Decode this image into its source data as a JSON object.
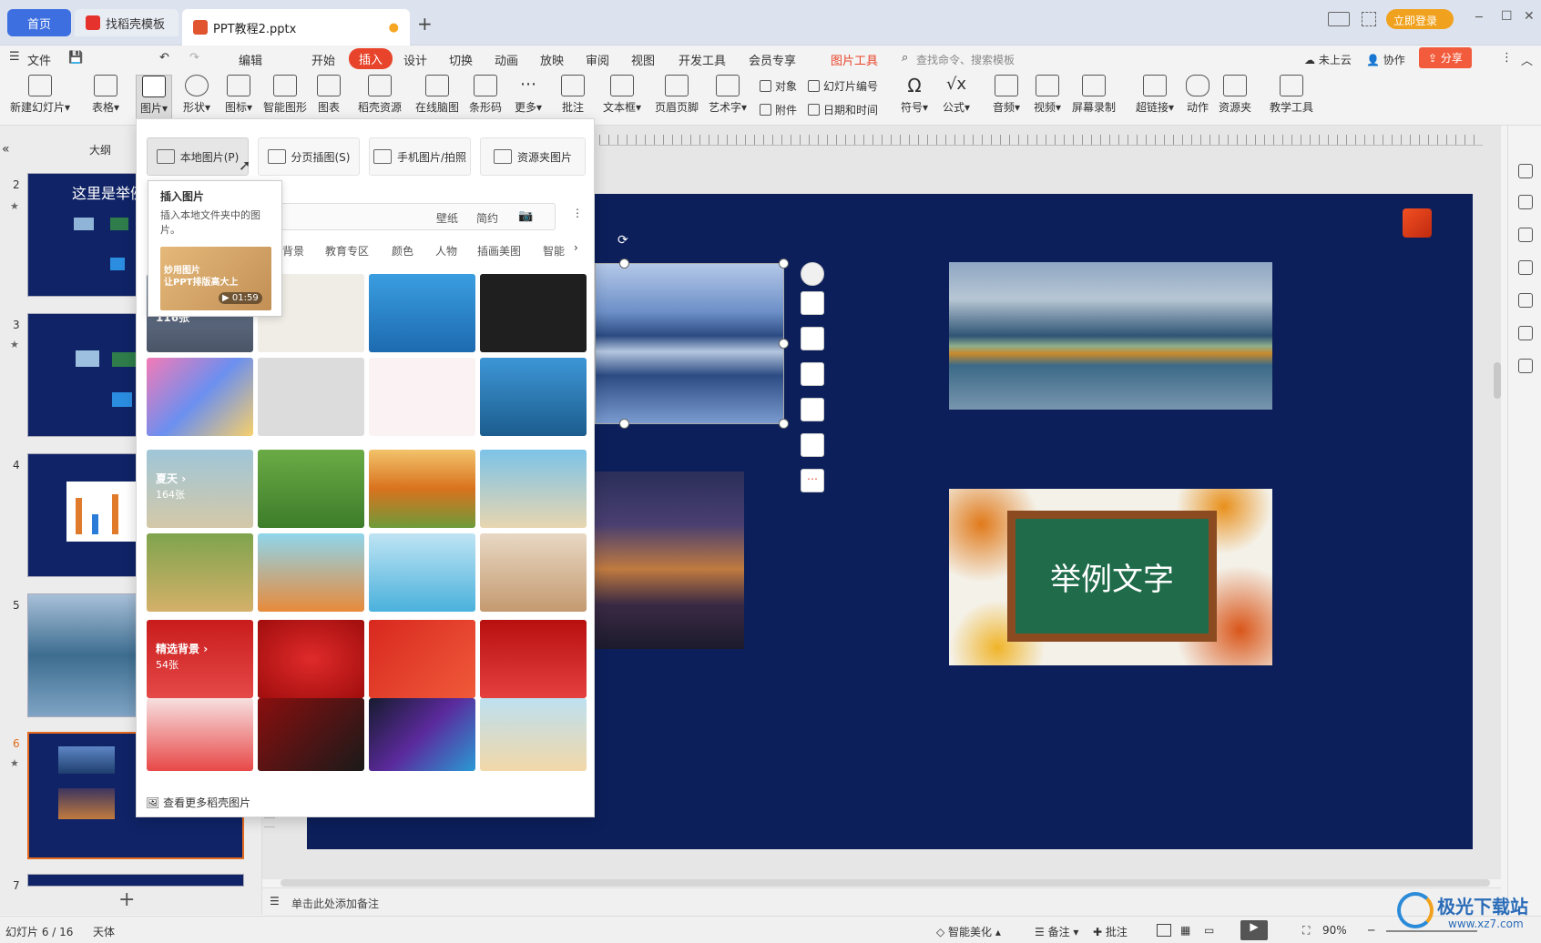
{
  "tabs": {
    "home": "首页",
    "template": "找稻壳模板",
    "doc": "PPT教程2.pptx",
    "add": "+"
  },
  "window": {
    "login": "立即登录",
    "min": "─",
    "max": "☐",
    "close": "✕"
  },
  "menu": {
    "file": "文件",
    "edit": "编辑",
    "items": [
      "开始",
      "插入",
      "设计",
      "切换",
      "动画",
      "放映",
      "审阅",
      "视图",
      "开发工具",
      "会员专享",
      "图片工具"
    ],
    "search": "查找命令、搜索模板",
    "cloud": "未上云",
    "collab": "协作",
    "share": "分享"
  },
  "ribbon": {
    "new_slide": "新建幻灯片",
    "table": "表格",
    "picture": "图片",
    "shape": "形状",
    "icon": "图标",
    "smart": "智能图形",
    "chart": "图表",
    "resource": "稻壳资源",
    "mindmap": "在线脑图",
    "barcode": "条形码",
    "more": "更多",
    "comment": "批注",
    "textbox": "文本框",
    "header": "页眉页脚",
    "wordart": "艺术字",
    "object": "对象",
    "attach": "附件",
    "slide_num": "幻灯片编号",
    "datetime": "日期和时间",
    "symbol": "符号",
    "formula": "公式",
    "audio": "音频",
    "video": "视频",
    "screen_rec": "屏幕录制",
    "hyperlink": "超链接",
    "action": "动作",
    "res_folder": "资源夹",
    "teach": "教学工具"
  },
  "left": {
    "outline": "大纲",
    "slide_nums": [
      "2",
      "3",
      "4",
      "5",
      "6",
      "7"
    ],
    "slide2_title": "这里是举例",
    "add": "+"
  },
  "dropdown": {
    "local": "本地图片(P)",
    "pages": "分页插图(S)",
    "phone": "手机图片/拍照",
    "folder": "资源夹图片",
    "search_wallpaper": "壁纸",
    "search_simple": "简约",
    "cats": [
      "背景",
      "教育专区",
      "颜色",
      "人物",
      "插画美图",
      "智能"
    ],
    "summer": "夏天",
    "summer_count": "164张",
    "bg": "精选背景",
    "bg_count": "54张",
    "first_count": "116张",
    "more": "查看更多稻壳图片"
  },
  "tooltip": {
    "title": "插入图片",
    "desc": "插入本地文件夹中的图片。",
    "video_title": "妙用图片\n让PPT排版高大上",
    "duration": "01:59"
  },
  "slide": {
    "text": "举例文字"
  },
  "notes": "单击此处添加备注",
  "status": {
    "slide": "幻灯片 6 / 16",
    "theme": "天体",
    "beautify": "智能美化",
    "notes": "备注",
    "comment": "批注",
    "zoom": "90%"
  },
  "watermark": "极光下载站",
  "watermark_url": "www.xz7.com"
}
